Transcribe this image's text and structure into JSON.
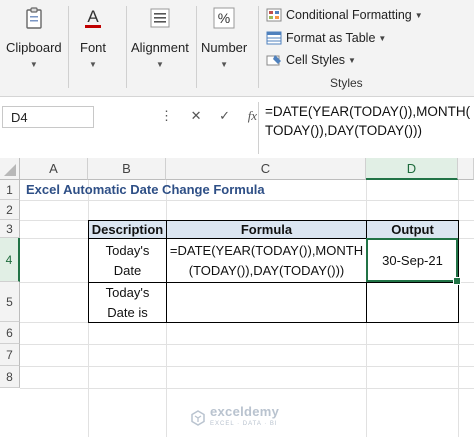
{
  "ribbon": {
    "clipboard_label": "Clipboard",
    "font_label": "Font",
    "alignment_label": "Alignment",
    "number_label": "Number",
    "number_icon_glyph": "%",
    "conditional_formatting_label": "Conditional Formatting",
    "format_as_table_label": "Format as Table",
    "cell_styles_label": "Cell Styles",
    "styles_group_label": "Styles"
  },
  "formula_bar": {
    "name_box": "D4",
    "fx_label": "fx",
    "formula_line1": "=DATE(YEAR(TODAY()),MONTH(",
    "formula_line2": "TODAY()),DAY(TODAY()))"
  },
  "columns": [
    "A",
    "B",
    "C",
    "D"
  ],
  "rows": [
    "1",
    "2",
    "3",
    "4",
    "5",
    "6",
    "7",
    "8"
  ],
  "sheet": {
    "title": "Excel Automatic Date Change Formula",
    "table": {
      "headers": [
        "Description",
        "Formula",
        "Output"
      ],
      "row1": {
        "desc_line1": "Today's",
        "desc_line2": "Date",
        "formula_line1": "=DATE(YEAR(TODAY()),MONTH",
        "formula_line2": "(TODAY()),DAY(TODAY()))",
        "output": "30-Sep-21"
      },
      "row2": {
        "desc_line1": "Today's",
        "desc_line2": "Date is",
        "formula": "",
        "output": ""
      }
    }
  },
  "watermark": {
    "name": "exceldemy",
    "tagline": "EXCEL · DATA · BI"
  },
  "colors": {
    "accent_green": "#217346",
    "title_blue": "#2e4f86",
    "header_fill": "#dbe5f1"
  }
}
